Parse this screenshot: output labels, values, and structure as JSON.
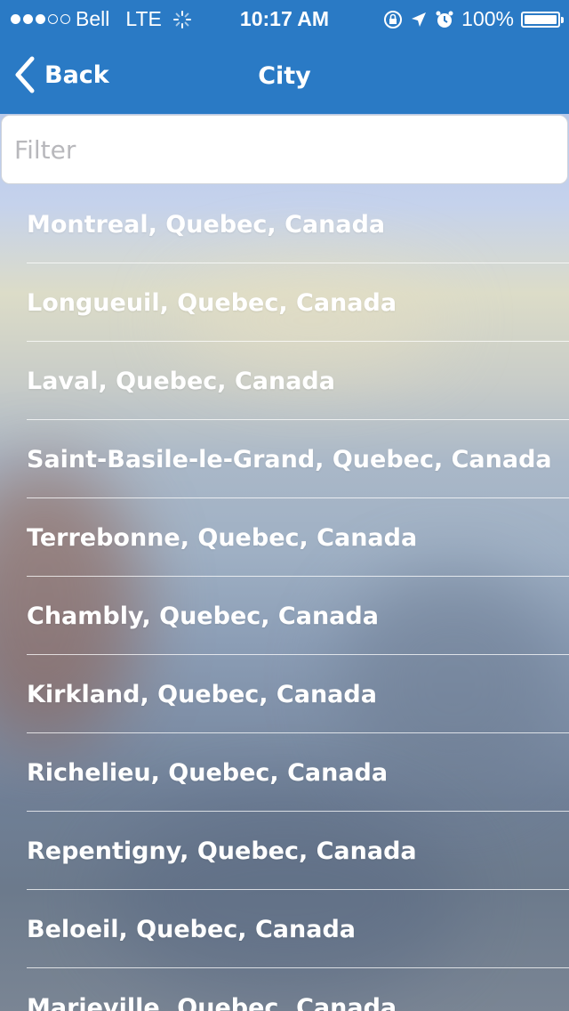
{
  "status_bar": {
    "carrier": "Bell",
    "network": "LTE",
    "time": "10:17 AM",
    "battery_percent": "100%",
    "battery_level": 1.0
  },
  "nav": {
    "back_label": "Back",
    "title": "City"
  },
  "filter": {
    "placeholder": "Filter",
    "value": ""
  },
  "cities": [
    "Montreal, Quebec, Canada",
    "Longueuil, Quebec, Canada",
    "Laval, Quebec, Canada",
    "Saint-Basile-le-Grand, Quebec, Canada",
    "Terrebonne, Quebec, Canada",
    "Chambly, Quebec, Canada",
    "Kirkland, Quebec, Canada",
    "Richelieu, Quebec, Canada",
    "Repentigny, Quebec, Canada",
    "Beloeil, Quebec, Canada",
    "Marieville, Quebec, Canada"
  ],
  "colors": {
    "nav_background": "#2a7ac5",
    "text_on_nav": "#ffffff"
  },
  "icons": {
    "back": "chevron-left-icon",
    "activity": "activity-spinner-icon",
    "rotation_lock": "rotation-lock-icon",
    "location": "location-arrow-icon",
    "alarm": "alarm-clock-icon",
    "battery": "battery-icon"
  }
}
